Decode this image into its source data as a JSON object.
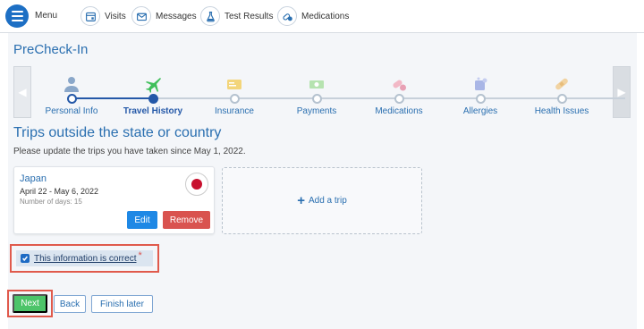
{
  "nav": {
    "menu_label": "Menu",
    "items": [
      {
        "label": "Visits",
        "icon": "calendar-icon"
      },
      {
        "label": "Messages",
        "icon": "envelope-icon"
      },
      {
        "label": "Test Results",
        "icon": "flask-icon"
      },
      {
        "label": "Medications",
        "icon": "pills-icon"
      }
    ]
  },
  "page": {
    "title": "PreCheck-In"
  },
  "steps": [
    {
      "label": "Personal Info",
      "icon": "person-icon",
      "state": "done"
    },
    {
      "label": "Travel History",
      "icon": "airplane-icon",
      "state": "current"
    },
    {
      "label": "Insurance",
      "icon": "card-icon",
      "state": "todo"
    },
    {
      "label": "Payments",
      "icon": "cash-icon",
      "state": "todo"
    },
    {
      "label": "Medications",
      "icon": "pills-icon",
      "state": "todo"
    },
    {
      "label": "Allergies",
      "icon": "allergy-icon",
      "state": "todo"
    },
    {
      "label": "Health Issues",
      "icon": "bandage-icon",
      "state": "todo"
    }
  ],
  "section": {
    "title": "Trips outside the state or country",
    "subtitle": "Please update the trips you have taken since May 1, 2022."
  },
  "trip": {
    "country": "Japan",
    "dates": "April 22 - May 6, 2022",
    "days": "Number of days: 15",
    "edit_label": "Edit",
    "remove_label": "Remove"
  },
  "add_trip_label": "Add a trip",
  "confirm": {
    "label": "This information is correct",
    "required_mark": "*",
    "checked": true
  },
  "footer": {
    "next_label": "Next",
    "back_label": "Back",
    "finish_label": "Finish later"
  },
  "colors": {
    "accent": "#2a6fb0",
    "primary_button": "#1e88e5",
    "danger": "#d9534f",
    "success": "#4cc469",
    "highlight": "#e05a4c"
  }
}
